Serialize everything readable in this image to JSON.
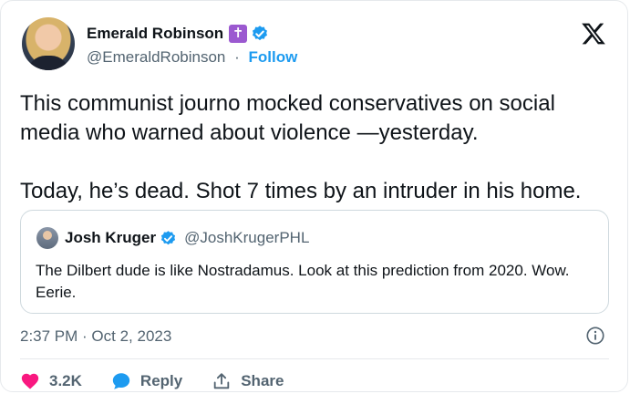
{
  "author": {
    "name": "Emerald Robinson",
    "handle": "@EmeraldRobinson",
    "separator": "·",
    "follow_label": "Follow",
    "badge_glyph": "✝",
    "badge_color": "#9b59d0",
    "verified_color": "#1d9bf0"
  },
  "tweet": {
    "paragraph_1": "This communist journo mocked conservatives on social media who warned about violence —yesterday.",
    "paragraph_2": "Today, he’s dead. Shot 7 times by an intruder in his home."
  },
  "quoted_tweet": {
    "name": "Josh Kruger",
    "handle": "@JoshKrugerPHL",
    "text": "The Dilbert dude is like Nostradamus. Look at this prediction from 2020. Wow. Eerie."
  },
  "meta": {
    "timestamp": "2:37 PM · Oct 2, 2023"
  },
  "actions": {
    "like_count": "3.2K",
    "reply_label": "Reply",
    "share_label": "Share"
  },
  "icons": {
    "logo": "x-logo-icon",
    "info": "info-icon",
    "like": "heart-icon",
    "reply": "chat-bubble-icon",
    "share": "share-icon"
  },
  "colors": {
    "link": "#1d9bf0",
    "like": "#f91880",
    "muted": "#536471",
    "text": "#0f1419"
  }
}
